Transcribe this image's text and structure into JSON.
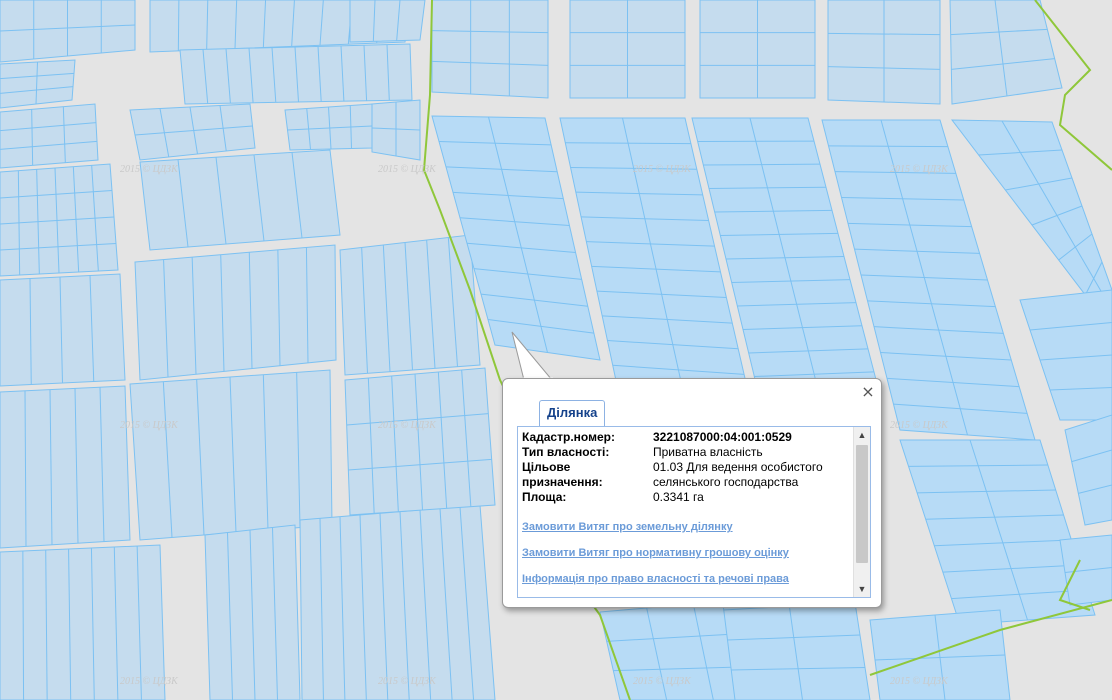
{
  "map": {
    "watermark": "2015 © ЦДЗК",
    "colors": {
      "background": "#e4e4e4",
      "parcel_fill": "#c5dcee",
      "parcel_fill_strong": "#b7dbf6",
      "parcel_line": "#7cc1f2",
      "boundary_green": "#8fc73a"
    }
  },
  "popup": {
    "tab_label": "Ділянка",
    "close_icon": "×",
    "fields": [
      {
        "label": "Кадастр.номер:",
        "value": "3221087000:04:001:0529"
      },
      {
        "label": "Тип власності:",
        "value": "Приватна власність"
      },
      {
        "label": "Цільове призначення:",
        "value": "01.03 Для ведення особистого селянського господарства"
      },
      {
        "label": "Площа:",
        "value": "0.3341 га"
      }
    ],
    "links": [
      "Замовити Витяг про земельну ділянку",
      "Замовити Витяг про нормативну грошову оцінку",
      "Інформація про право власності та речові права"
    ],
    "scroll_up": "▲",
    "scroll_down": "▼"
  }
}
